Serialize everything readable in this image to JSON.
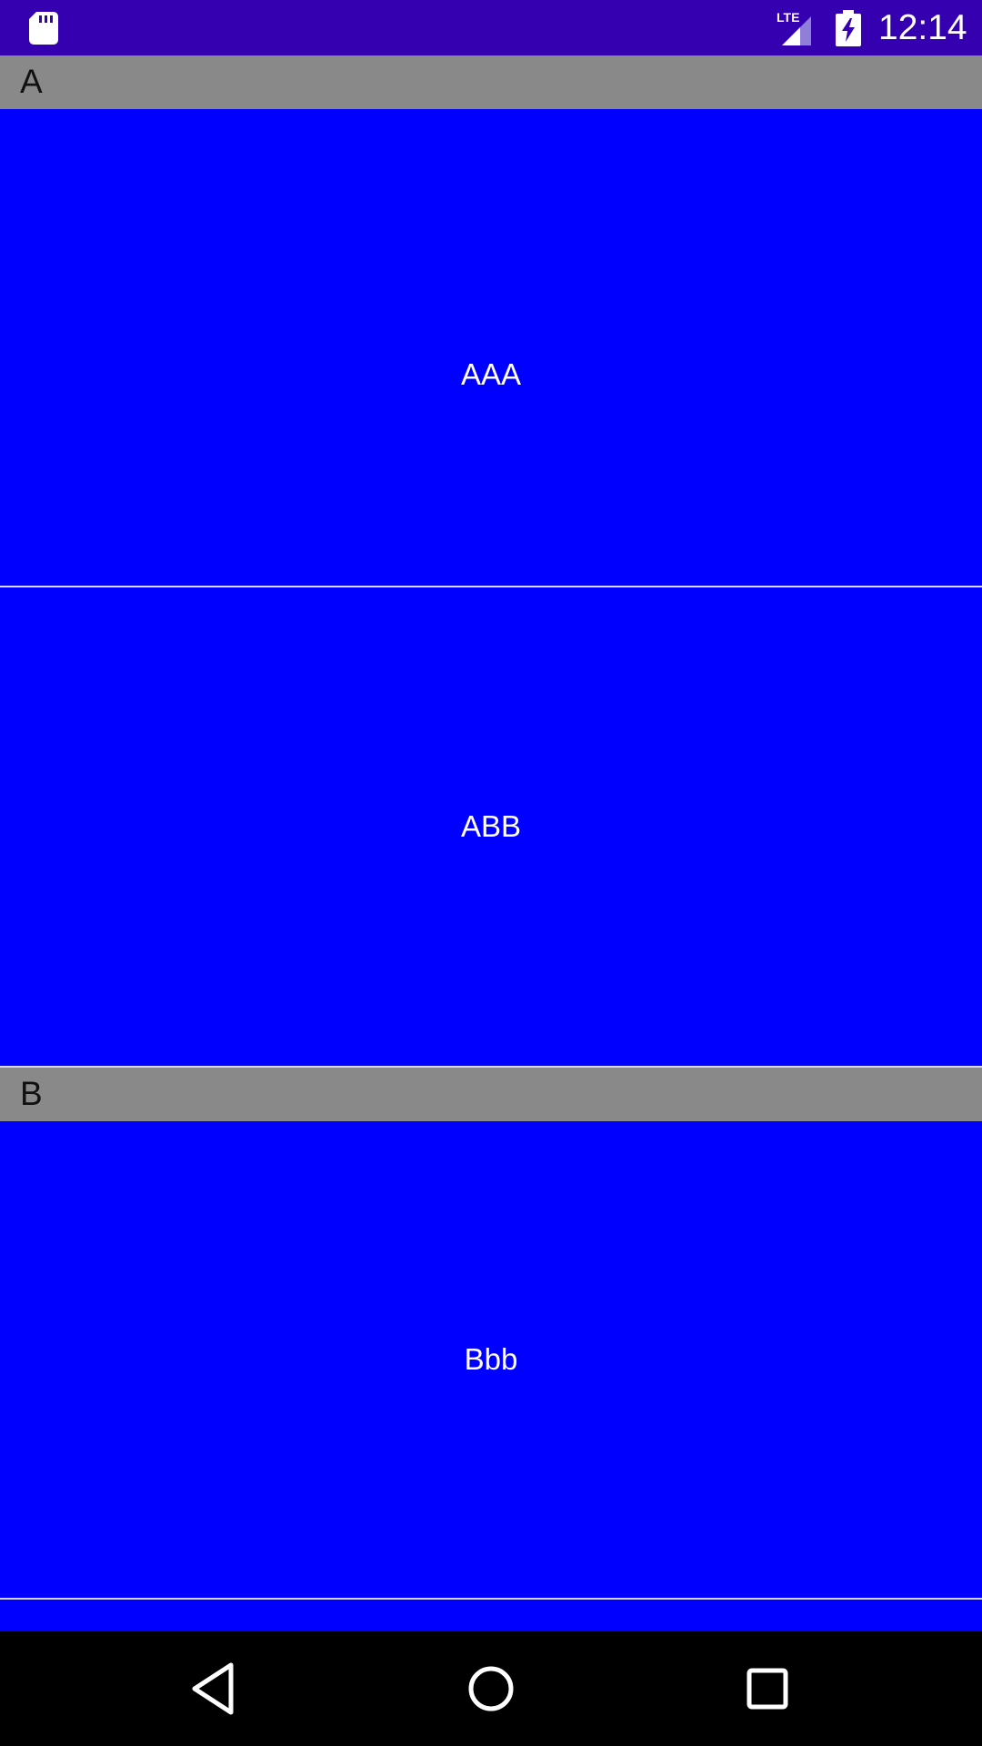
{
  "status_bar": {
    "time": "12:14",
    "network": "LTE",
    "colors": {
      "background": "#3400b0"
    }
  },
  "list": {
    "background": "#0000ff",
    "header_background": "#898989",
    "sections": [
      {
        "header": "A",
        "items": [
          "AAA",
          "ABB"
        ]
      },
      {
        "header": "B",
        "items": [
          "Bbb"
        ]
      }
    ]
  },
  "nav_bar": {
    "buttons": [
      "back-icon",
      "home-icon",
      "recents-icon"
    ]
  }
}
